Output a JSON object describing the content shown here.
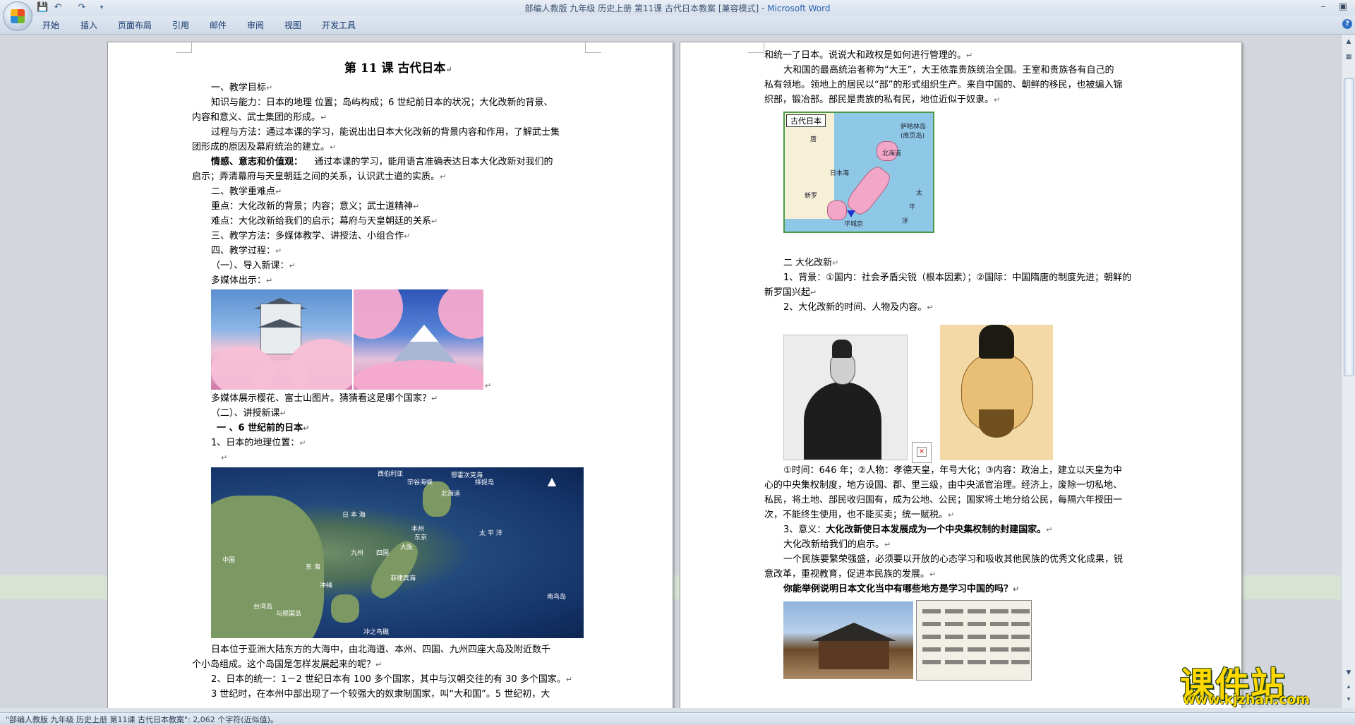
{
  "window": {
    "title": "部编人教版 九年级 历史上册 第11课 古代日本教案 [兼容模式] - Microsoft Word",
    "title_doc": "部编人教版 九年级 历史上册 第11课 古代日本教案 [兼容模式] - ",
    "title_app": "Microsoft Word"
  },
  "ribbon": {
    "tabs": [
      "开始",
      "插入",
      "页面布局",
      "引用",
      "邮件",
      "审阅",
      "视图",
      "开发工具"
    ]
  },
  "left_page": {
    "title": "第 11 课  古代日本",
    "paras": [
      "一、教学目标",
      "知识与能力：日本的地理  位置；岛屿构成；6 世纪前日本的状况；大化改新的背景、",
      "内容和意义、武士集团的形成。",
      "过程与方法：通过本课的学习，能说出出日本大化改新的背景内容和作用，了解武士集",
      "团形成的原因及幕府统治的建立。",
      "情感、意志和价值观：",
      "通过本课的学习，能用语言准确表达日本大化改新对我们的",
      "启示；弄清幕府与天皇朝廷之间的关系，认识武士道的实质。",
      "二、教学重难点",
      "重点：大化改新的背景；内容；意义；武士道精神",
      "难点：大化改新给我们的启示；幕府与天皇朝廷的关系",
      "三、教学方法：多媒体教学、讲授法、小组合作",
      "四、教学过程：",
      "（一）、导入新课：",
      "多媒体出示：",
      "多媒体展示樱花、富士山图片。猜猜看这是哪个国家？",
      "（二）、讲授新课",
      "一    、6 世纪前的日本",
      "1、日本的地理位置：",
      "日本位于亚洲大陆东方的大海中，由北海道、本州、四国、九州四座大岛及附近数千",
      "个小岛组成。这个岛国是怎样发展起来的呢？",
      "2、日本的统一：1－2 世纪日本有 100 多个国家，其中与汉朝交往的有 30 多个国家。",
      "3 世纪时，在本州中部出现了一个较强大的奴隶制国家，叫“大和国”。5 世纪初，大"
    ],
    "map_labels": [
      "西伯利亚",
      "宗谷海峡",
      "鄂霍次克海",
      "择捉岛",
      "北海道",
      "日 本 海",
      "本州",
      "太 平 洋",
      "九州",
      "四国",
      "大阪",
      "东京",
      "中国",
      "东 海",
      "菲律宾海",
      "冲绳",
      "冲之鸟礁",
      "南鸟岛",
      "与那国岛",
      "台湾岛"
    ]
  },
  "right_page": {
    "paras": [
      "和统一了日本。说说大和政权是如何进行管理的。",
      "大和国的最高统治者称为“大王”，大王依靠贵族统治全国。王室和贵族各有自己的",
      "私有领地。领地上的居民以“部”的形式组织生产。来自中国的、朝鲜的移民，也被编入锦",
      "织部，锻冶部。部民是贵族的私有民，地位近似于奴隶。",
      "二    大化改新",
      "1、背景：①国内：社会矛盾尖锐（根本因素）；②国际：中国隋唐的制度先进；朝鲜的",
      "新罗国兴起",
      "2、大化改新的时间、人物及内容。",
      "①时间：646 年；②人物：孝德天皇，年号大化；③内容：政治上，建立以天皇为中",
      "心的中央集权制度，地方设国、郡、里三级，由中央派官治理。经济上，废除一切私地、",
      "私民，将土地、部民收归国有，成为公地、公民；国家将土地分给公民，每隔六年授田一",
      "次，不能终生使用，也不能买卖；统一赋税。",
      "3、意义：",
      "大化改新使日本发展成为一个中央集权制的封建国家。",
      "大化改新给我们的启示。",
      "一个民族要繁荣强盛，必须要以开放的心态学习和吸收其他民族的优秀文化成果，锐",
      "意改革，重视教育，促进本民族的发展。",
      "你能举例说明日本文化当中有哪些地方是学习中国的吗？"
    ],
    "map_caption": "古代日本",
    "map_labels": [
      "唐",
      "萨哈林岛(库页岛)",
      "日本海",
      "新罗",
      "平城京",
      "太",
      "平",
      "洋",
      "北海道"
    ]
  },
  "status": {
    "text": "\"部编人教版 九年级 历史上册 第11课 古代日本教案\": 2,062 个字符(近似值)。"
  },
  "watermark": {
    "brand": "课件站",
    "url": "www.kjzhan.com"
  },
  "icons": {
    "office_button": "office-logo-icon",
    "save": "save-icon",
    "undo": "undo-icon",
    "redo": "redo-icon",
    "help": "help-icon"
  }
}
